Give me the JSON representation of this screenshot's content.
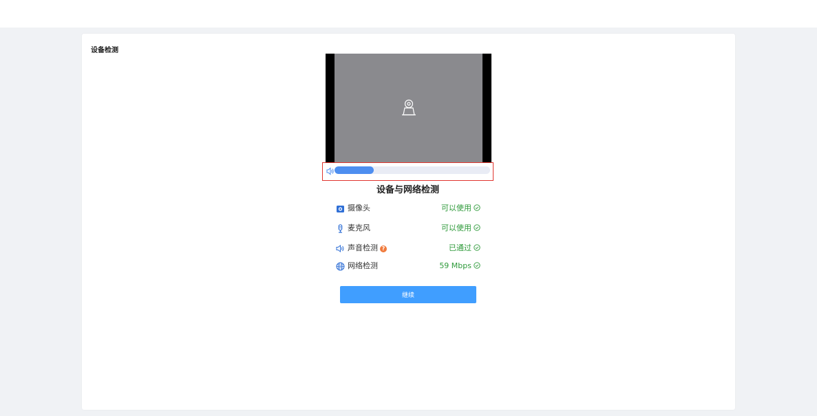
{
  "card": {
    "title": "设备检测"
  },
  "volume": {
    "level_percent": 25
  },
  "section": {
    "title": "设备与网络检测"
  },
  "checks": [
    {
      "icon": "camera-icon",
      "label": "摄像头",
      "status": "可以使用"
    },
    {
      "icon": "microphone-icon",
      "label": "麦克风",
      "status": "可以使用"
    },
    {
      "icon": "speaker-icon",
      "label": "声音检测",
      "status": "已通过",
      "help": "?"
    },
    {
      "icon": "globe-icon",
      "label": "网络检测",
      "status": "59 Mbps"
    }
  ],
  "actions": {
    "continue_label": "继续"
  },
  "colors": {
    "accent": "#409eff",
    "success": "#2e9a3a",
    "highlight_border": "#e0342d",
    "help_badge": "#f07a3c"
  }
}
